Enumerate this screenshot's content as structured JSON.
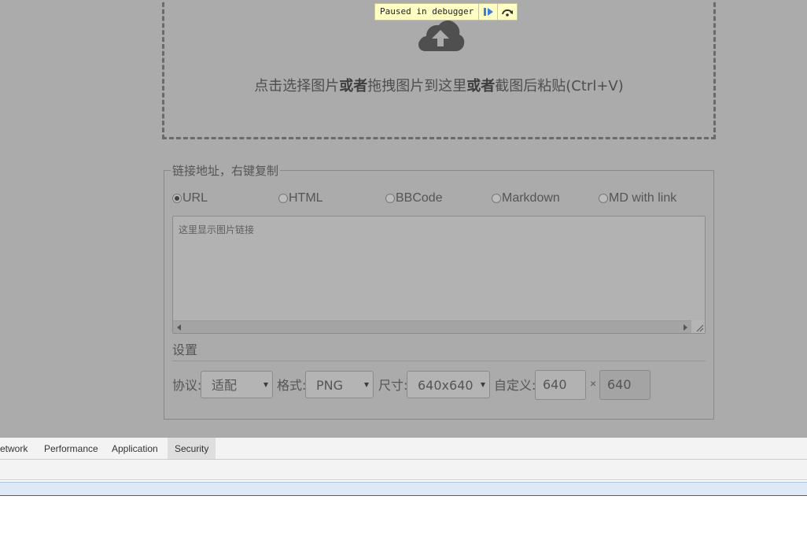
{
  "page": {
    "upload": {
      "text_part1": "点击选择图片",
      "text_or1": "或者",
      "text_part2": "拖拽图片到这里",
      "text_or2": "或者",
      "text_part3": "截图后粘贴(Ctrl+V)",
      "icon": "cloud-upload-icon"
    },
    "links": {
      "legend": "链接地址，右键复制",
      "formats": [
        {
          "label": "URL",
          "selected": true
        },
        {
          "label": "HTML",
          "selected": false
        },
        {
          "label": "BBCode",
          "selected": false
        },
        {
          "label": "Markdown",
          "selected": false
        },
        {
          "label": "MD with link",
          "selected": false
        }
      ],
      "placeholder": "这里显示图片链接"
    },
    "settings": {
      "title": "设置",
      "protocol_label": "协议:",
      "protocol_value": "适配",
      "format_label": "格式:",
      "format_value": "PNG",
      "size_label": "尺寸:",
      "size_value": "640x640",
      "custom_label": "自定义:",
      "width_value": "640",
      "times": "×",
      "height_value": "640"
    }
  },
  "debugger": {
    "paused_text": "Paused in debugger",
    "resume_icon": "resume-icon",
    "step_over_icon": "step-over-icon"
  },
  "devtools": {
    "tabs": [
      "etwork",
      "Performance",
      "Application",
      "Security"
    ],
    "active_tab": "Security"
  },
  "colors": {
    "overlay": "#ababab",
    "badge": "#ffffc4",
    "selection": "#dfe8f6"
  }
}
